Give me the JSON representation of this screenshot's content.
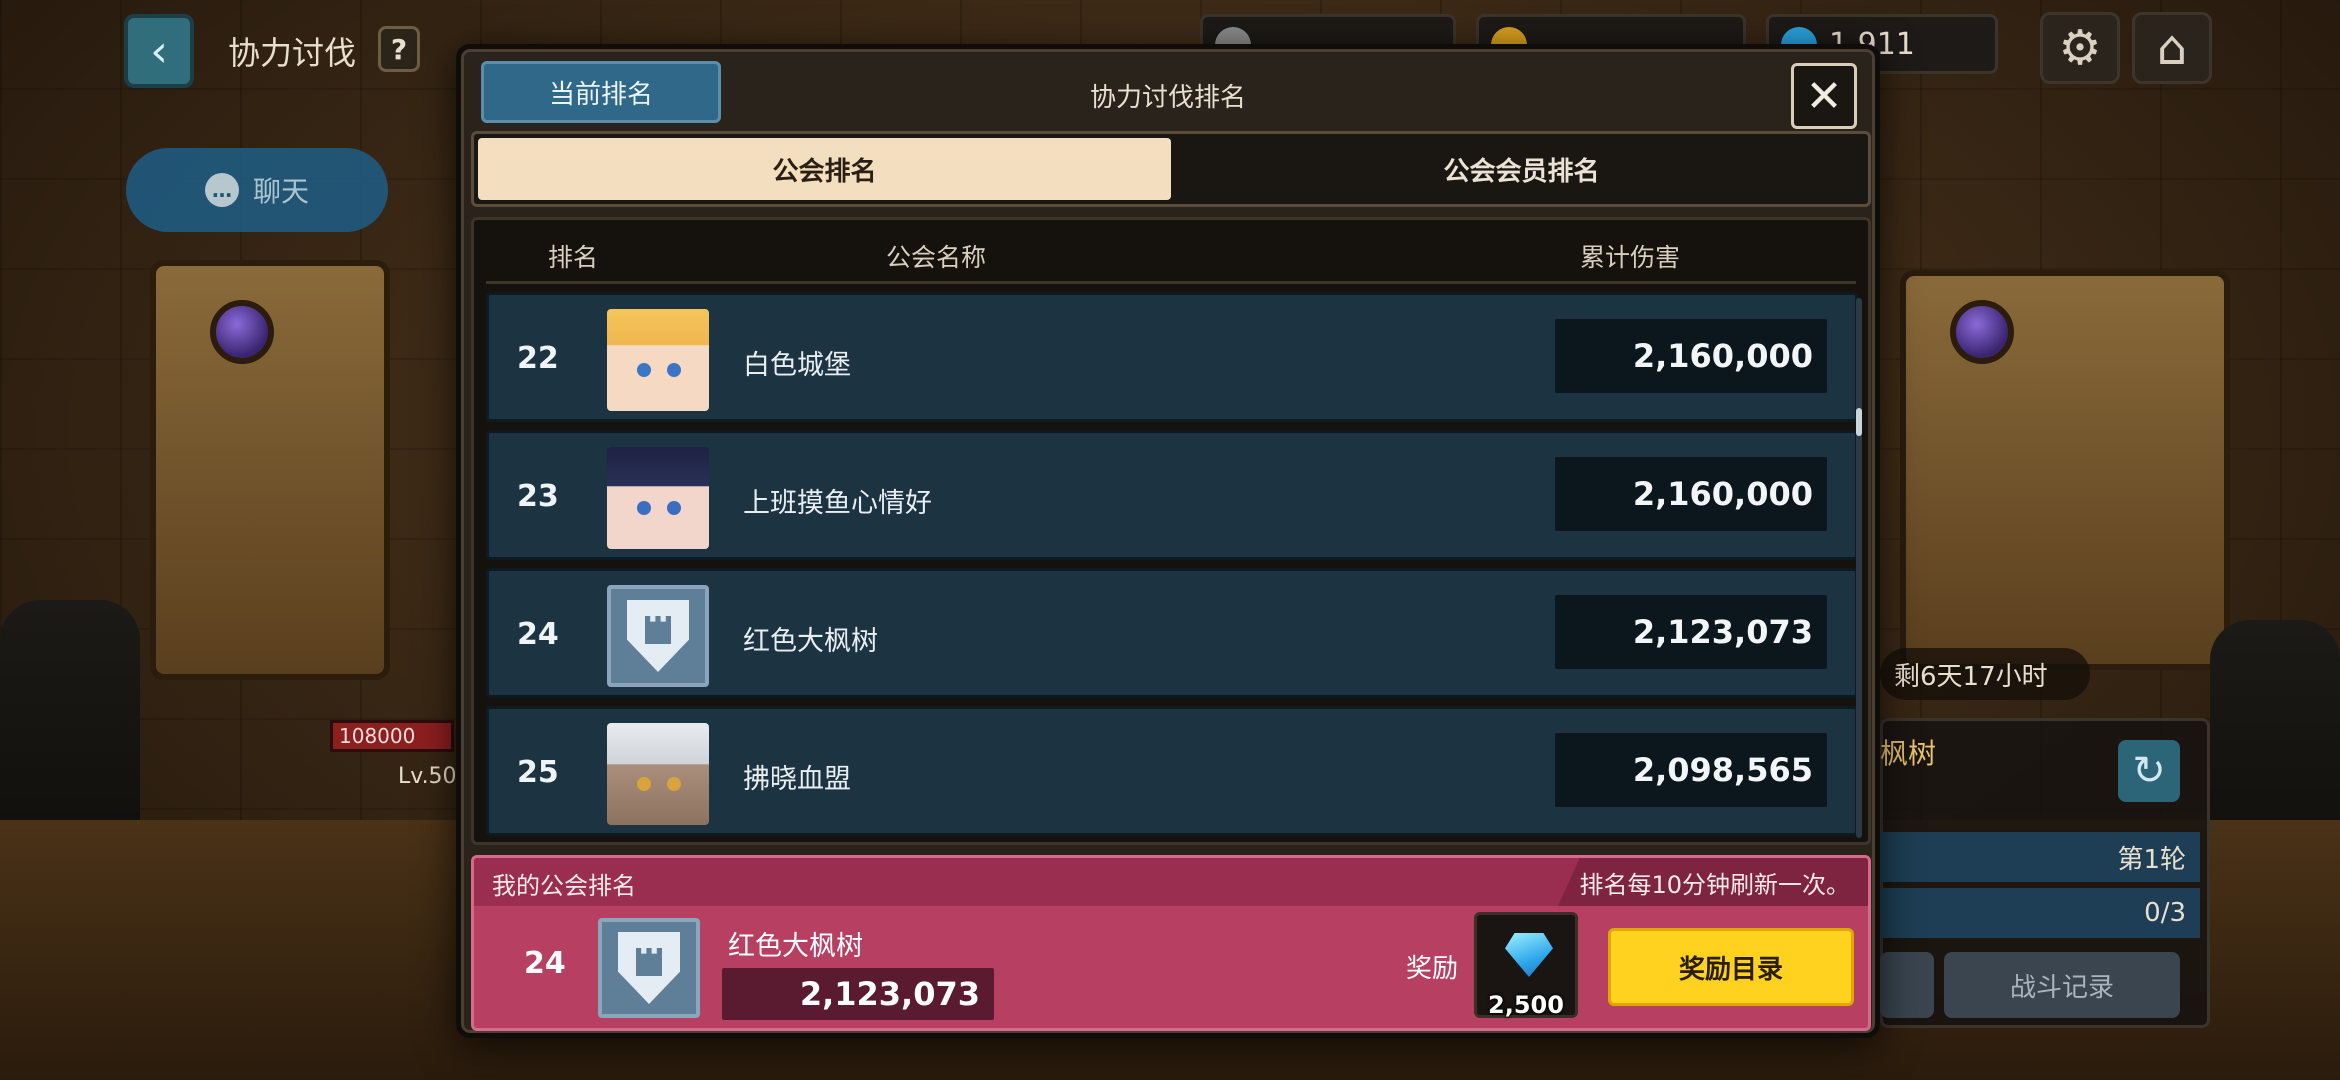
{
  "hud": {
    "title": "协力讨伐",
    "help_label": "?",
    "chat_label": "聊天",
    "currency_gems": "1,911"
  },
  "side": {
    "timer": "剩6天17小时",
    "guild_label": "枫树",
    "round": "第1轮",
    "attempts": "0/3",
    "battle_log": "战斗记录"
  },
  "boss": {
    "hp": "108000",
    "level": "Lv.50"
  },
  "modal": {
    "current_tab": "当前排名",
    "title": "协力讨伐排名",
    "close_icon": "✕",
    "segments": [
      {
        "label": "公会排名",
        "active": true
      },
      {
        "label": "公会会员排名",
        "active": false
      }
    ],
    "columns": {
      "rank": "排名",
      "name": "公会名称",
      "damage": "累计伤害"
    },
    "rows": [
      {
        "rank": "22",
        "name": "白色城堡",
        "damage": "2,160,000",
        "avatar": "portrait-blonde"
      },
      {
        "rank": "23",
        "name": "上班摸鱼心情好",
        "damage": "2,160,000",
        "avatar": "portrait-dark-hair"
      },
      {
        "rank": "24",
        "name": "红色大枫树",
        "damage": "2,123,073",
        "avatar": "shield-castle-emblem"
      },
      {
        "rank": "25",
        "name": "拂晓血盟",
        "damage": "2,098,565",
        "avatar": "portrait-white-hair"
      }
    ]
  },
  "my_guild": {
    "label": "我的公会排名",
    "note": "排名每10分钟刷新一次。",
    "rank": "24",
    "name": "红色大枫树",
    "damage": "2,123,073",
    "reward_label": "奖励",
    "reward_qty": "2,500",
    "reward_button": "奖励目录"
  },
  "colors": {
    "accent_blue": "#2f6889",
    "row_bg": "#1c3342",
    "my_bar": "#b63f62",
    "reward_button": "#ffd21f"
  }
}
